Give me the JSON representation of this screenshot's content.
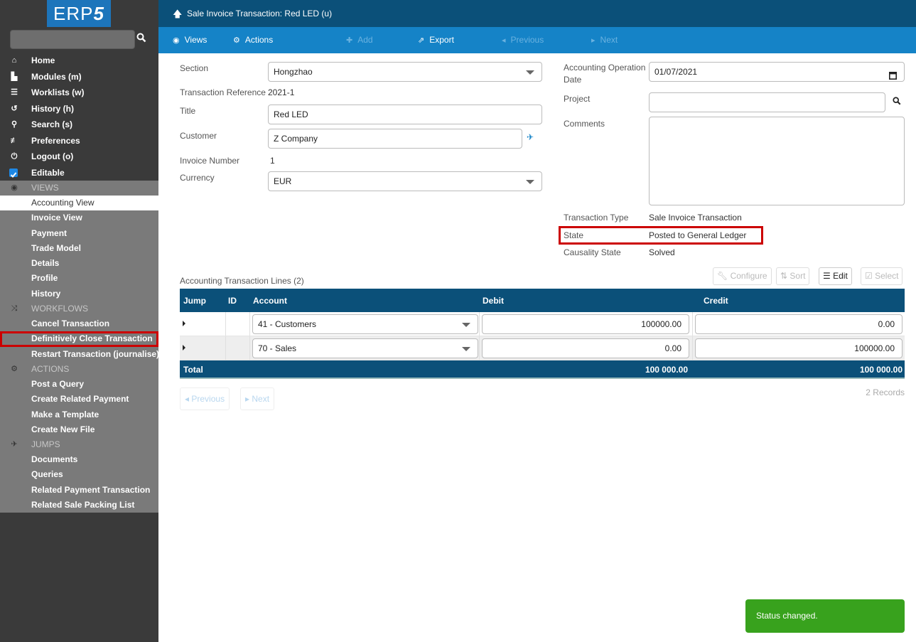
{
  "logo": {
    "text": "ERP",
    "accent": "5"
  },
  "sidebar": {
    "search_placeholder": "",
    "nav": [
      {
        "icon": "home-icon",
        "glyph": "⌂",
        "label": "Home"
      },
      {
        "icon": "modules-icon",
        "glyph": "▙",
        "label": "Modules (m)"
      },
      {
        "icon": "worklists-icon",
        "glyph": "☰",
        "label": "Worklists (w)"
      },
      {
        "icon": "history-icon",
        "glyph": "↺",
        "label": "History (h)"
      },
      {
        "icon": "search-icon",
        "glyph": "⚲",
        "label": "Search (s)"
      },
      {
        "icon": "preferences-icon",
        "glyph": "≢",
        "label": "Preferences"
      },
      {
        "icon": "logout-icon",
        "glyph": "⏻",
        "label": "Logout (o)"
      },
      {
        "icon": "checkbox-icon",
        "glyph": "",
        "label": "Editable"
      }
    ],
    "views": {
      "header": "VIEWS",
      "items": [
        "Accounting View",
        "Invoice View",
        "Payment",
        "Trade Model",
        "Details",
        "Profile",
        "History"
      ]
    },
    "workflows": {
      "header": "WORKFLOWS",
      "items": [
        "Cancel Transaction",
        "Definitively Close Transaction",
        "Restart Transaction (journalise)"
      ]
    },
    "actions": {
      "header": "ACTIONS",
      "items": [
        "Post a Query",
        "Create Related Payment",
        "Make a Template",
        "Create New File"
      ]
    },
    "jumps": {
      "header": "JUMPS",
      "items": [
        "Documents",
        "Queries",
        "Related Payment Transaction",
        "Related Sale Packing List"
      ]
    }
  },
  "header": {
    "title": "Sale Invoice Transaction: Red LED (u)"
  },
  "toolbar": {
    "views": "Views",
    "actions": "Actions",
    "add": "Add",
    "export": "Export",
    "previous": "Previous",
    "next": "Next"
  },
  "form": {
    "section": {
      "label": "Section",
      "value": "Hongzhao"
    },
    "reference": {
      "label": "Transaction Reference",
      "value": "2021-1"
    },
    "title": {
      "label": "Title",
      "value": "Red LED"
    },
    "customer": {
      "label": "Customer",
      "value": "Z Company"
    },
    "invoice_number": {
      "label": "Invoice Number",
      "value": "1"
    },
    "currency": {
      "label": "Currency",
      "value": "EUR"
    },
    "operation_date": {
      "label_line1": "Accounting Operation",
      "label_line2": "Date",
      "value": "01/07/2021"
    },
    "project": {
      "label": "Project",
      "value": ""
    },
    "comments": {
      "label": "Comments",
      "value": ""
    },
    "transaction_type": {
      "label": "Transaction Type",
      "value": "Sale Invoice Transaction"
    },
    "state": {
      "label": "State",
      "value": "Posted to General Ledger"
    },
    "causality_state": {
      "label": "Causality State",
      "value": "Solved"
    }
  },
  "lines": {
    "title": "Accounting Transaction Lines (2)",
    "buttons": {
      "configure": "Configure",
      "sort": "Sort",
      "edit": "Edit",
      "select": "Select"
    },
    "columns": [
      "Jump",
      "ID",
      "Account",
      "Debit",
      "Credit"
    ],
    "rows": [
      {
        "id": "",
        "account": "41 - Customers",
        "debit": "100000.00",
        "credit": "0.00"
      },
      {
        "id": "",
        "account": "70 - Sales",
        "debit": "0.00",
        "credit": "100000.00"
      }
    ],
    "total": {
      "label": "Total",
      "debit": "100 000.00",
      "credit": "100 000.00"
    },
    "pager": {
      "previous": "Previous",
      "next": "Next"
    },
    "records": "2 Records"
  },
  "toast": {
    "message": "Status changed."
  },
  "colors": {
    "header_dark": "#0b5079",
    "toolbar_blue": "#1583c7",
    "sidebar_dark": "#3a3a3a",
    "sidebar_section": "#7a7a7a",
    "highlight_red": "#cc0000",
    "toast_green": "#38a21d"
  }
}
